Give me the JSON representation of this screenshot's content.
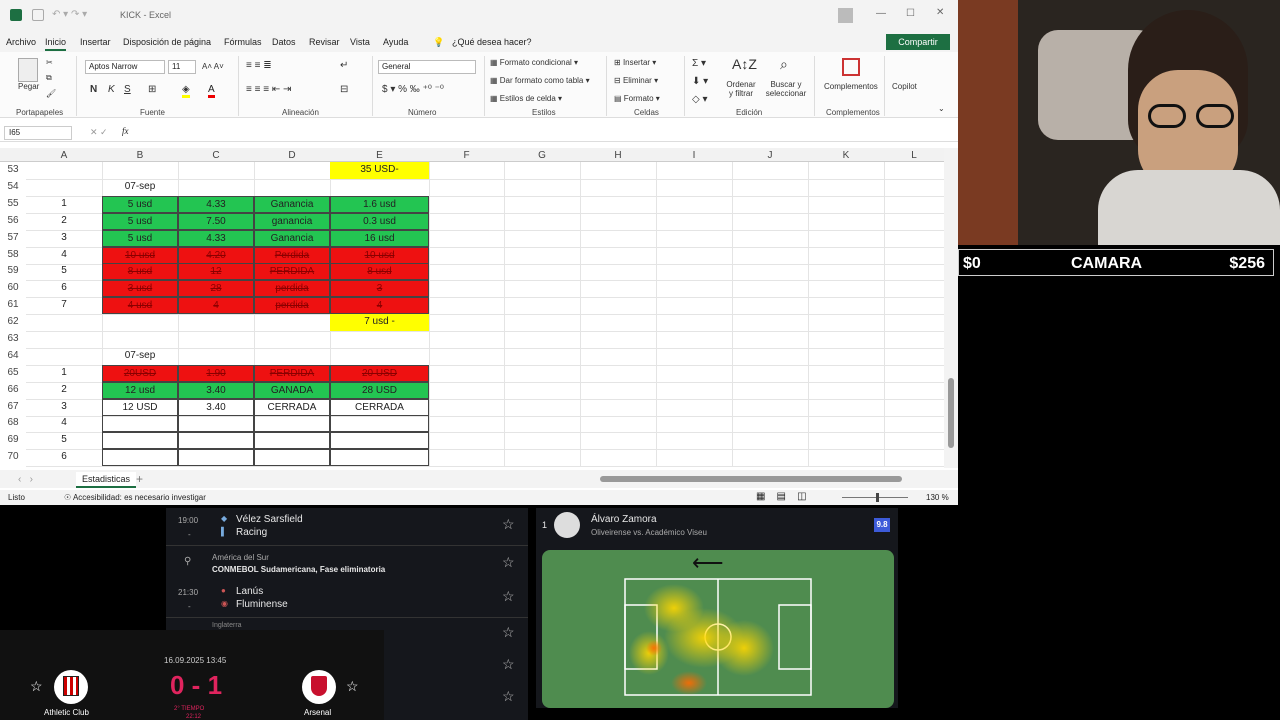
{
  "window": {
    "title": "KICK - Excel"
  },
  "menu": [
    "Archivo",
    "Inicio",
    "Insertar",
    "Disposición de página",
    "Fórmulas",
    "Datos",
    "Revisar",
    "Vista",
    "Ayuda"
  ],
  "tellme": "¿Qué desea hacer?",
  "share": "Compartir",
  "ribbon": {
    "paste": "Pegar",
    "clipboard": "Portapapeles",
    "font_name": "Aptos Narrow",
    "font_size": "11",
    "font_group": "Fuente",
    "align_group": "Alineación",
    "number_format": "General",
    "number_group": "Número",
    "cond_format": "Formato condicional",
    "table_format": "Dar formato como tabla",
    "cell_styles": "Estilos de celda",
    "styles_group": "Estilos",
    "insert": "Insertar",
    "delete": "Eliminar",
    "format": "Formato",
    "cells_group": "Celdas",
    "sort": "Ordenar y filtrar",
    "find": "Buscar y seleccionar",
    "edit_group": "Edición",
    "addins": "Complementos",
    "addins_group": "Complementos",
    "copilot": "Copilot"
  },
  "namebox": "I65",
  "columns": [
    "A",
    "B",
    "C",
    "D",
    "E",
    "F",
    "G",
    "H",
    "I",
    "J",
    "K",
    "L"
  ],
  "rows": [
    {
      "n": "53",
      "cells": [
        {
          "col": "E",
          "text": "35 USD-",
          "style": "y"
        }
      ]
    },
    {
      "n": "54",
      "cells": [
        {
          "col": "B",
          "text": "07-sep",
          "style": ""
        }
      ]
    },
    {
      "n": "55",
      "cells": [
        {
          "col": "A",
          "text": "1"
        },
        {
          "col": "B",
          "text": "5 usd",
          "style": "g"
        },
        {
          "col": "C",
          "text": "4.33",
          "style": "g"
        },
        {
          "col": "D",
          "text": "Ganancia",
          "style": "g"
        },
        {
          "col": "E",
          "text": "1.6 usd",
          "style": "g"
        }
      ]
    },
    {
      "n": "56",
      "cells": [
        {
          "col": "A",
          "text": "2"
        },
        {
          "col": "B",
          "text": "5 usd",
          "style": "g"
        },
        {
          "col": "C",
          "text": "7.50",
          "style": "g"
        },
        {
          "col": "D",
          "text": "ganancia",
          "style": "g"
        },
        {
          "col": "E",
          "text": "0.3 usd",
          "style": "g"
        }
      ]
    },
    {
      "n": "57",
      "cells": [
        {
          "col": "A",
          "text": "3"
        },
        {
          "col": "B",
          "text": "5 usd",
          "style": "g"
        },
        {
          "col": "C",
          "text": "4.33",
          "style": "g"
        },
        {
          "col": "D",
          "text": "Ganancia",
          "style": "g"
        },
        {
          "col": "E",
          "text": "16 usd",
          "style": "g"
        }
      ]
    },
    {
      "n": "58",
      "cells": [
        {
          "col": "A",
          "text": "4"
        },
        {
          "col": "B",
          "text": "10 usd",
          "style": "r"
        },
        {
          "col": "C",
          "text": "4.20",
          "style": "r"
        },
        {
          "col": "D",
          "text": "Perdida",
          "style": "r"
        },
        {
          "col": "E",
          "text": "10 usd",
          "style": "r"
        }
      ]
    },
    {
      "n": "59",
      "cells": [
        {
          "col": "A",
          "text": "5"
        },
        {
          "col": "B",
          "text": "8 usd",
          "style": "r"
        },
        {
          "col": "C",
          "text": "12",
          "style": "r"
        },
        {
          "col": "D",
          "text": "PERDIDA",
          "style": "r"
        },
        {
          "col": "E",
          "text": "8 usd",
          "style": "r"
        }
      ]
    },
    {
      "n": "60",
      "cells": [
        {
          "col": "A",
          "text": "6"
        },
        {
          "col": "B",
          "text": "3 usd",
          "style": "r"
        },
        {
          "col": "C",
          "text": "28",
          "style": "r"
        },
        {
          "col": "D",
          "text": "perdida",
          "style": "r"
        },
        {
          "col": "E",
          "text": "3",
          "style": "r"
        }
      ]
    },
    {
      "n": "61",
      "cells": [
        {
          "col": "A",
          "text": "7"
        },
        {
          "col": "B",
          "text": "4 usd",
          "style": "r"
        },
        {
          "col": "C",
          "text": "4",
          "style": "r"
        },
        {
          "col": "D",
          "text": "perdida",
          "style": "r"
        },
        {
          "col": "E",
          "text": "4",
          "style": "r"
        }
      ]
    },
    {
      "n": "62",
      "cells": [
        {
          "col": "E",
          "text": "7 usd -",
          "style": "y"
        }
      ]
    },
    {
      "n": "63",
      "cells": []
    },
    {
      "n": "64",
      "cells": [
        {
          "col": "B",
          "text": "07-sep",
          "style": ""
        }
      ]
    },
    {
      "n": "65",
      "cells": [
        {
          "col": "A",
          "text": "1"
        },
        {
          "col": "B",
          "text": "20USD",
          "style": "r"
        },
        {
          "col": "C",
          "text": "1.90",
          "style": "r"
        },
        {
          "col": "D",
          "text": "PERDIDA",
          "style": "r"
        },
        {
          "col": "E",
          "text": "20 USD",
          "style": "r"
        }
      ]
    },
    {
      "n": "66",
      "cells": [
        {
          "col": "A",
          "text": "2"
        },
        {
          "col": "B",
          "text": "12 usd",
          "style": "g"
        },
        {
          "col": "C",
          "text": "3.40",
          "style": "g"
        },
        {
          "col": "D",
          "text": "GANADA",
          "style": "g"
        },
        {
          "col": "E",
          "text": "28 USD",
          "style": "g"
        }
      ]
    },
    {
      "n": "67",
      "cells": [
        {
          "col": "A",
          "text": "3"
        },
        {
          "col": "B",
          "text": "12 USD",
          "style": "w"
        },
        {
          "col": "C",
          "text": "3.40",
          "style": "w"
        },
        {
          "col": "D",
          "text": "CERRADA",
          "style": "w"
        },
        {
          "col": "E",
          "text": "CERRADA",
          "style": "w"
        }
      ]
    },
    {
      "n": "68",
      "cells": [
        {
          "col": "A",
          "text": "4"
        },
        {
          "col": "B",
          "text": "",
          "style": "w"
        },
        {
          "col": "C",
          "text": "",
          "style": "w"
        },
        {
          "col": "D",
          "text": "",
          "style": "w"
        },
        {
          "col": "E",
          "text": "",
          "style": "w"
        }
      ]
    },
    {
      "n": "69",
      "cells": [
        {
          "col": "A",
          "text": "5"
        },
        {
          "col": "B",
          "text": "",
          "style": "w"
        },
        {
          "col": "C",
          "text": "",
          "style": "w"
        },
        {
          "col": "D",
          "text": "",
          "style": "w"
        },
        {
          "col": "E",
          "text": "",
          "style": "w"
        }
      ]
    },
    {
      "n": "70",
      "cells": [
        {
          "col": "A",
          "text": "6"
        },
        {
          "col": "B",
          "text": "",
          "style": "w"
        },
        {
          "col": "C",
          "text": "",
          "style": "w"
        },
        {
          "col": "D",
          "text": "",
          "style": "w"
        },
        {
          "col": "E",
          "text": "",
          "style": "w"
        }
      ]
    }
  ],
  "sheet_tab": "Estadisticas",
  "status": {
    "ready": "Listo",
    "accessibility": "Accesibilidad: es necesario investigar",
    "zoom": "130 %"
  },
  "overlay": {
    "left": "$0",
    "center": "CAMARA",
    "right": "$256"
  },
  "scores": {
    "m1": {
      "time": "19:00",
      "dash": "-",
      "home": "Vélez Sarsfield",
      "away": "Racing"
    },
    "league": {
      "region": "América del Sur",
      "name": "CONMEBOL Sudamericana, Fase eliminatoria"
    },
    "m2": {
      "time": "21:30",
      "dash": "-",
      "home": "Lanús",
      "away": "Fluminense"
    },
    "peek": "Inglaterra"
  },
  "player": {
    "rank": "1",
    "name": "Álvaro Zamora",
    "match": "Oliveirense vs. Académico Viseu",
    "rating": "9.8"
  },
  "match": {
    "date": "16.09.2025 13:45",
    "score": "0 - 1",
    "period": "2° TIEMPO",
    "clock": "22:12",
    "home": "Athletic Club",
    "away": "Arsenal"
  }
}
